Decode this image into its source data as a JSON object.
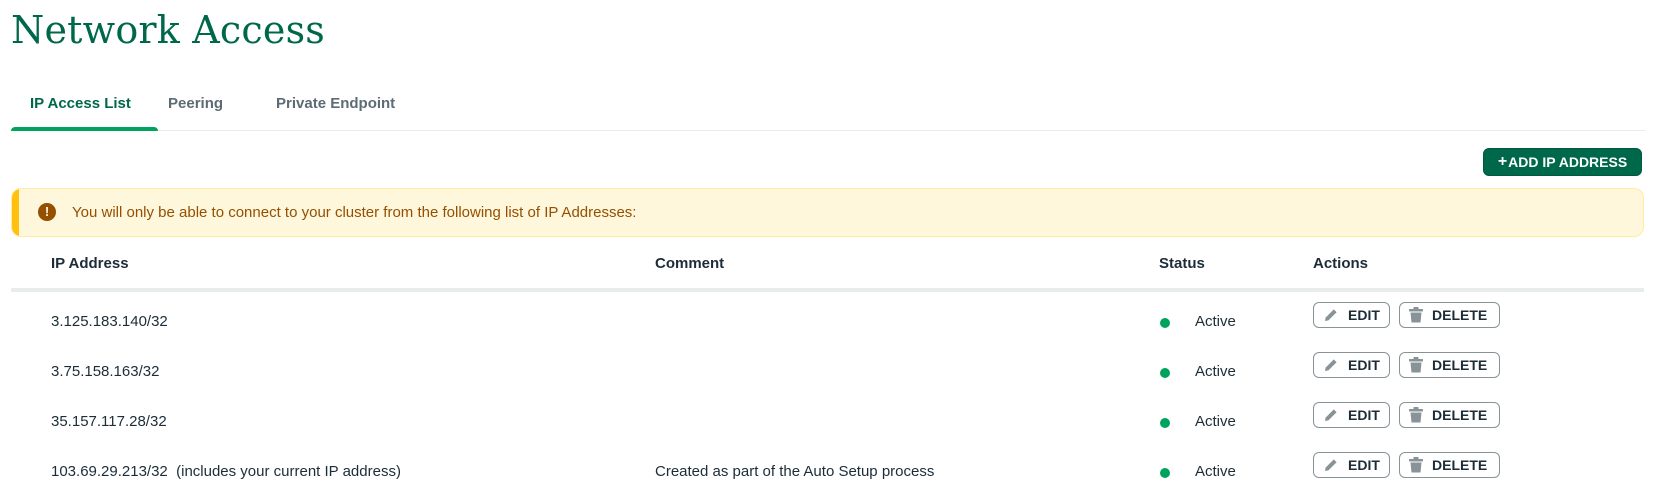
{
  "page": {
    "title": "Network Access"
  },
  "tabs": [
    {
      "label": "IP Access List",
      "active": true
    },
    {
      "label": "Peering",
      "active": false
    },
    {
      "label": "Private Endpoint",
      "active": false
    }
  ],
  "toolbar": {
    "add_label": "ADD IP ADDRESS",
    "add_icon": "+"
  },
  "banner": {
    "icon": "!",
    "text": "You will only be able to connect to your cluster from the following list of IP Addresses:"
  },
  "table": {
    "headers": {
      "ip": "IP Address",
      "comment": "Comment",
      "status": "Status",
      "actions": "Actions"
    },
    "rows": [
      {
        "ip": "3.125.183.140/32",
        "comment": "",
        "status": "Active"
      },
      {
        "ip": "3.75.158.163/32",
        "comment": "",
        "status": "Active"
      },
      {
        "ip": "35.157.117.28/32",
        "comment": "",
        "status": "Active"
      },
      {
        "ip": "103.69.29.213/32  (includes your current IP address)",
        "comment": "Created as part of the Auto Setup process",
        "status": "Active"
      }
    ],
    "edit_label": "EDIT",
    "delete_label": "DELETE"
  },
  "colors": {
    "brand_green": "#00684a",
    "accent_green": "#00a35c",
    "warning_bg": "#fef7db",
    "warning_text": "#944f01",
    "warning_bar": "#ffc010"
  }
}
